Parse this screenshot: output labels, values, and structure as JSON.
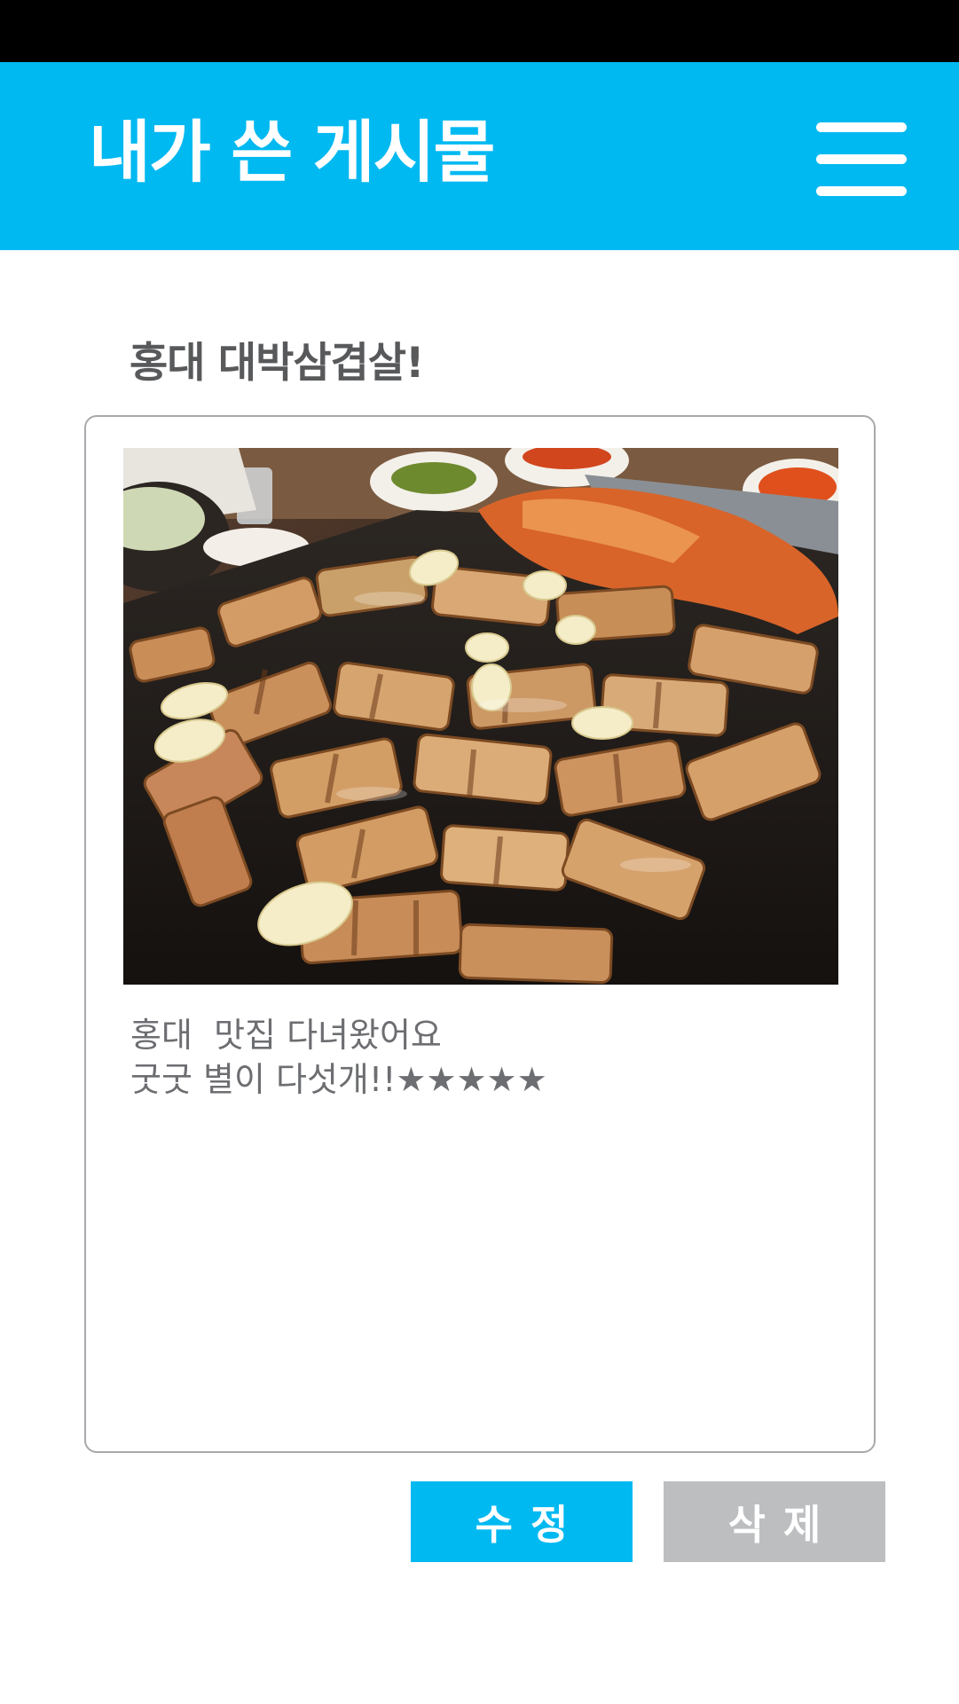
{
  "header": {
    "title": "내가 쓴 게시물",
    "menu_icon": "hamburger-menu-icon",
    "background_color": "#00b9f1"
  },
  "post": {
    "title": "홍대 대박삼겹살!",
    "photo_description": "grilled pork belly (samgyeopsal) with garlic and kimchi on a grill",
    "body_lines": [
      "홍대  맛집 다녀왔어요",
      "굿굿 별이 다섯개!!★★★★★"
    ]
  },
  "actions": {
    "edit_label": "수정",
    "delete_label": "삭제",
    "edit_color": "#00b9f1",
    "delete_color": "#bcbec0"
  }
}
